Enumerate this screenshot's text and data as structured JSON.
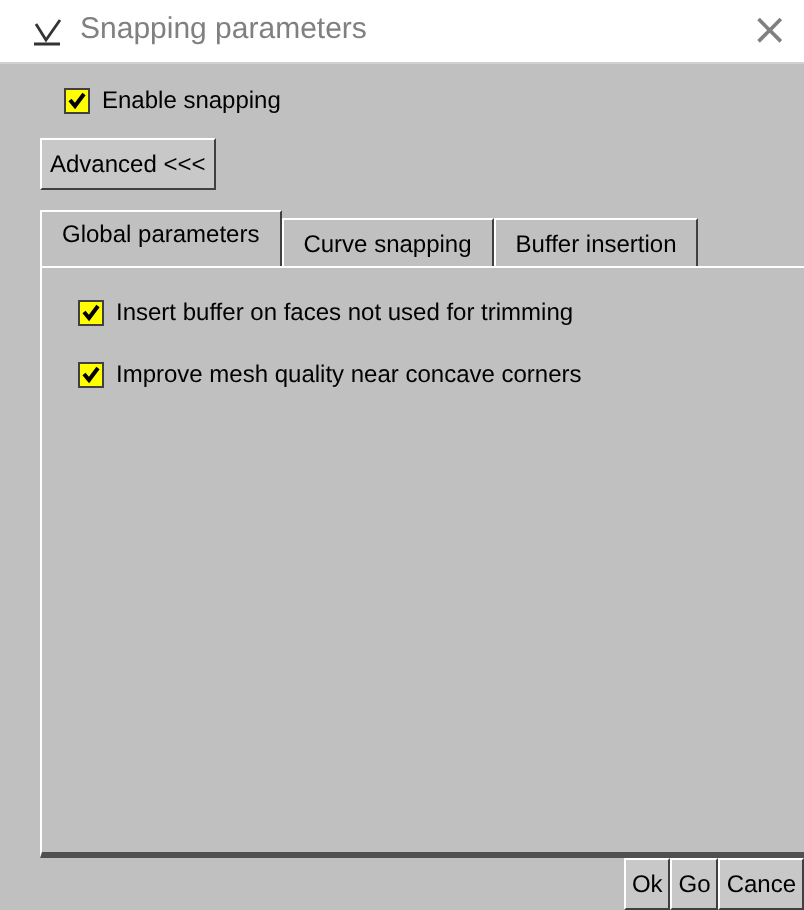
{
  "window": {
    "title": "Snapping parameters",
    "close": "×"
  },
  "enable_snapping": {
    "label": "Enable snapping",
    "checked": true
  },
  "advanced_button": "Advanced <<<",
  "tabs": [
    {
      "label": "Global parameters",
      "selected": true
    },
    {
      "label": "Curve snapping",
      "selected": false
    },
    {
      "label": "Buffer insertion",
      "selected": false
    }
  ],
  "options": [
    {
      "label": "Insert buffer on faces not used for trimming",
      "checked": true
    },
    {
      "label": "Improve mesh quality near concave corners",
      "checked": true
    }
  ],
  "buttons": [
    "Ok",
    "Go",
    "Cance"
  ]
}
